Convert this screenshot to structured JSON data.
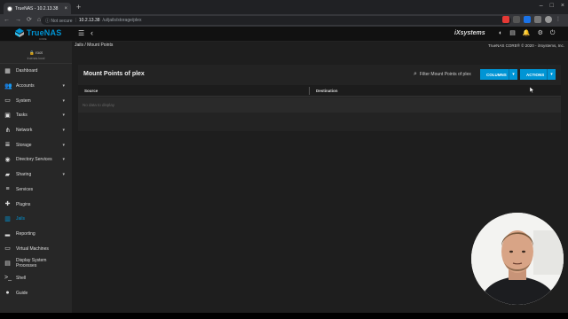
{
  "browser": {
    "tab_title": "TrueNAS - 10.2.13.38",
    "tab_close": "×",
    "new_tab": "+",
    "window_controls": [
      "–",
      "□",
      "×"
    ],
    "nav": [
      "←",
      "→",
      "⟳",
      "⌂"
    ],
    "security": "ⓘ Not secure",
    "url_host": "10.2.13.38",
    "url_path": "/ui/jails/storage/plex",
    "star": "☆"
  },
  "topbar": {
    "logo_text": "TrueNAS",
    "logo_sub": "CORE",
    "menu_icon": "☰",
    "back_icon": "‹",
    "brand": "iXsystems",
    "icons": [
      "◐",
      "▤",
      "🔔",
      "⚙",
      "⏻"
    ]
  },
  "sidebar": {
    "user": "root",
    "host": "truenas.local",
    "items": [
      {
        "label": "Dashboard",
        "icon": "▦",
        "arrow": ""
      },
      {
        "label": "Accounts",
        "icon": "👥",
        "arrow": "▾"
      },
      {
        "label": "System",
        "icon": "▭",
        "arrow": "▾"
      },
      {
        "label": "Tasks",
        "icon": "▣",
        "arrow": "▾"
      },
      {
        "label": "Network",
        "icon": "⋔",
        "arrow": "▾"
      },
      {
        "label": "Storage",
        "icon": "≣",
        "arrow": "▾"
      },
      {
        "label": "Directory Services",
        "icon": "◉",
        "arrow": "▾"
      },
      {
        "label": "Sharing",
        "icon": "▰",
        "arrow": "▾"
      },
      {
        "label": "Services",
        "icon": "≡",
        "arrow": ""
      },
      {
        "label": "Plugins",
        "icon": "✚",
        "arrow": ""
      },
      {
        "label": "Jails",
        "icon": "▥",
        "arrow": ""
      },
      {
        "label": "Reporting",
        "icon": "▂",
        "arrow": ""
      },
      {
        "label": "Virtual Machines",
        "icon": "▭",
        "arrow": ""
      },
      {
        "label": "Display System Processes",
        "icon": "▤",
        "arrow": ""
      },
      {
        "label": "Shell",
        "icon": ">_",
        "arrow": ""
      },
      {
        "label": "Guide",
        "icon": "●",
        "arrow": ""
      }
    ],
    "active_index": 10
  },
  "main": {
    "breadcrumb": "Jails  /  Mount Points",
    "copyright": "TrueNAS CORE® © 2020 - iXsystems, Inc.",
    "card_title": "Mount Points of plex",
    "filter_placeholder": "Filter Mount Points of plex",
    "search_icon": "⌕",
    "columns_label": "COLUMNS",
    "actions_label": "ACTIONS",
    "dropdown_icon": "▾",
    "table_headers": [
      "Source",
      "Destination"
    ],
    "empty_text": "No data to display"
  },
  "colors": {
    "accent": "#0095d5",
    "background": "#1e1e1e",
    "sidebar": "#272727"
  }
}
